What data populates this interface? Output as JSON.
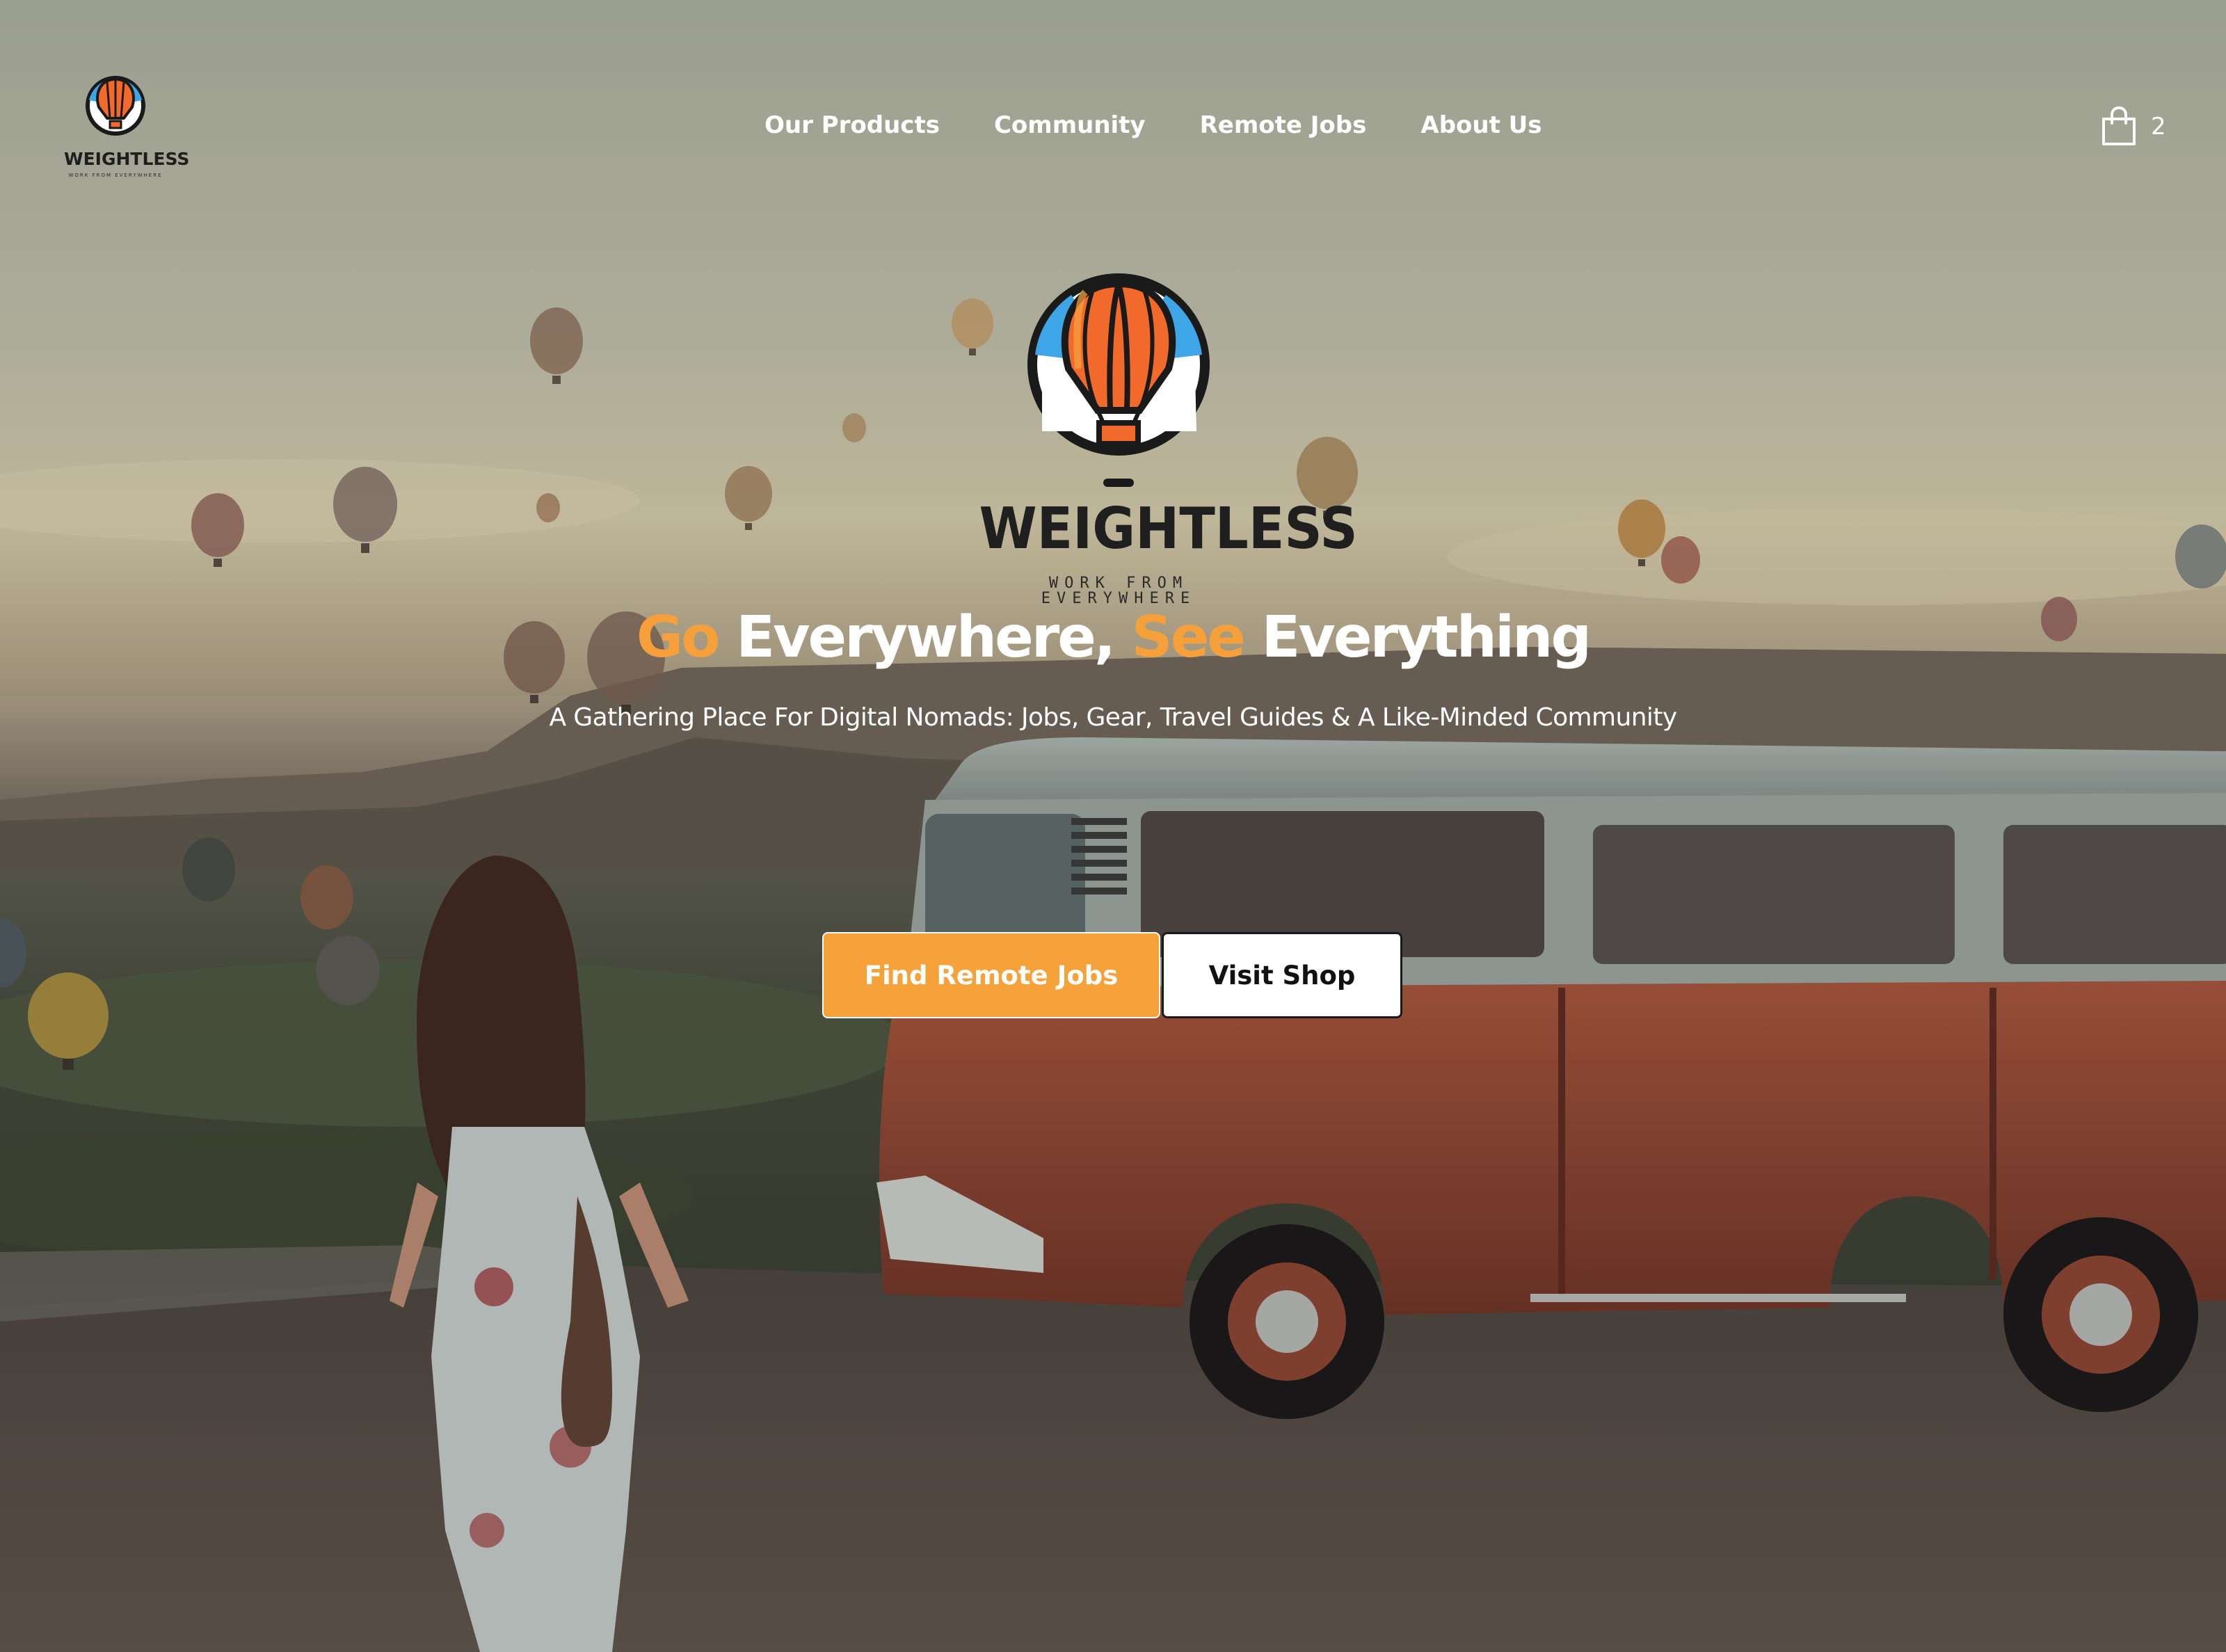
{
  "brand": {
    "name": "WEIGHTLESS",
    "tagline": "WORK FROM EVERYWHERE"
  },
  "nav": {
    "items": [
      {
        "label": "Our Products"
      },
      {
        "label": "Community"
      },
      {
        "label": "Remote Jobs"
      },
      {
        "label": "About Us"
      }
    ]
  },
  "cart": {
    "icon": "shopping-bag-icon",
    "count": "2"
  },
  "hero": {
    "headline": {
      "part1": "Go",
      "part2": " Everywhere, ",
      "part3": "See",
      "part4": " Everything"
    },
    "subheadline": "A Gathering Place For Digital Nomads: Jobs, Gear, Travel Guides & A Like-Minded Community",
    "primary_button": "Find Remote Jobs",
    "secondary_button": "Visit Shop"
  },
  "colors": {
    "accent": "#f5a03a",
    "text_light": "#ffffff",
    "logo_dark": "#1f1f1f",
    "balloon_orange": "#f26a2b",
    "balloon_blue": "#3ea6e6",
    "van_orange": "#b25a3f"
  }
}
